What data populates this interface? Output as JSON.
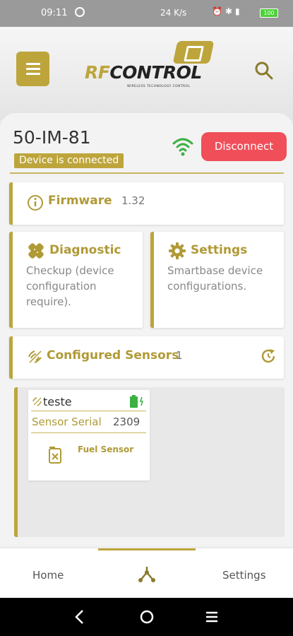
{
  "statusbar": {
    "time": "09:11",
    "speed": "24 K/s",
    "battery": "100"
  },
  "header": {
    "logo_rf": "RF",
    "logo_control": "CONTROL",
    "logo_tagline": "WIRELESS TECHNOLOGY CONTROL"
  },
  "device": {
    "name": "50-IM-81",
    "status": "Device is connected",
    "disconnect_label": "Disconnect"
  },
  "firmware": {
    "title": "Firmware",
    "version": "1.32"
  },
  "diagnostic": {
    "title": "Diagnostic",
    "description": "Checkup (device configuration require)."
  },
  "settings_card": {
    "title": "Settings",
    "description": "Smartbase device configurations."
  },
  "sensors": {
    "title": "Configured Sensors",
    "count": "1",
    "items": [
      {
        "name": "teste",
        "serial_label": "Sensor Serial",
        "serial": "2309",
        "type": "Fuel Sensor"
      }
    ]
  },
  "bottom_nav": {
    "home": "Home",
    "settings": "Settings"
  },
  "colors": {
    "accent": "#bda53c",
    "danger": "#f04f5a",
    "wifi": "#3cb043"
  }
}
